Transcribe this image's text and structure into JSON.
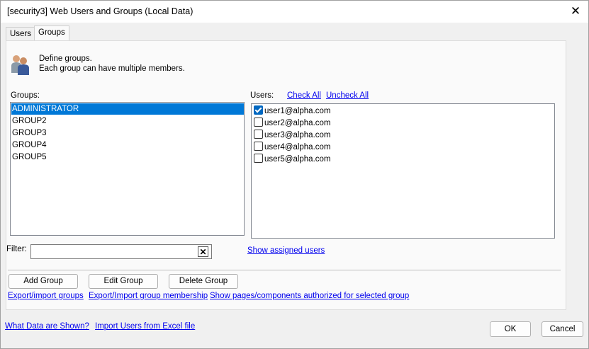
{
  "window": {
    "title": "[security3] Web Users and Groups (Local Data)"
  },
  "tabs": [
    {
      "label": "Users",
      "active": false
    },
    {
      "label": "Groups",
      "active": true
    }
  ],
  "description": {
    "line1": "Define groups.",
    "line2": "Each group can have multiple members."
  },
  "groups": {
    "label": "Groups:",
    "items": [
      "ADMINISTRATOR",
      "GROUP2",
      "GROUP3",
      "GROUP4",
      "GROUP5"
    ],
    "selected_index": 0
  },
  "users": {
    "label": "Users:",
    "check_all": "Check All",
    "uncheck_all": "Uncheck All",
    "items": [
      {
        "email": "user1@alpha.com",
        "checked": true
      },
      {
        "email": "user2@alpha.com",
        "checked": false
      },
      {
        "email": "user3@alpha.com",
        "checked": false
      },
      {
        "email": "user4@alpha.com",
        "checked": false
      },
      {
        "email": "user5@alpha.com",
        "checked": false
      }
    ]
  },
  "filter": {
    "label": "Filter:",
    "value": ""
  },
  "show_assigned": "Show assigned users",
  "actions": {
    "add": "Add Group",
    "edit": "Edit Group",
    "delete": "Delete Group"
  },
  "links": {
    "export_groups": "Export/import groups",
    "export_membership": "Export/Import group membership",
    "show_pages": "Show pages/components authorized for selected group"
  },
  "footer": {
    "what_data": "What Data are Shown?",
    "import_excel": "Import Users from Excel file",
    "ok": "OK",
    "cancel": "Cancel"
  },
  "icons": {
    "close": "close-icon",
    "people": "people-icon",
    "clear": "clear-icon"
  },
  "colors": {
    "selection": "#0078d7",
    "link": "#0000ee",
    "checkbox": "#0067c0"
  }
}
